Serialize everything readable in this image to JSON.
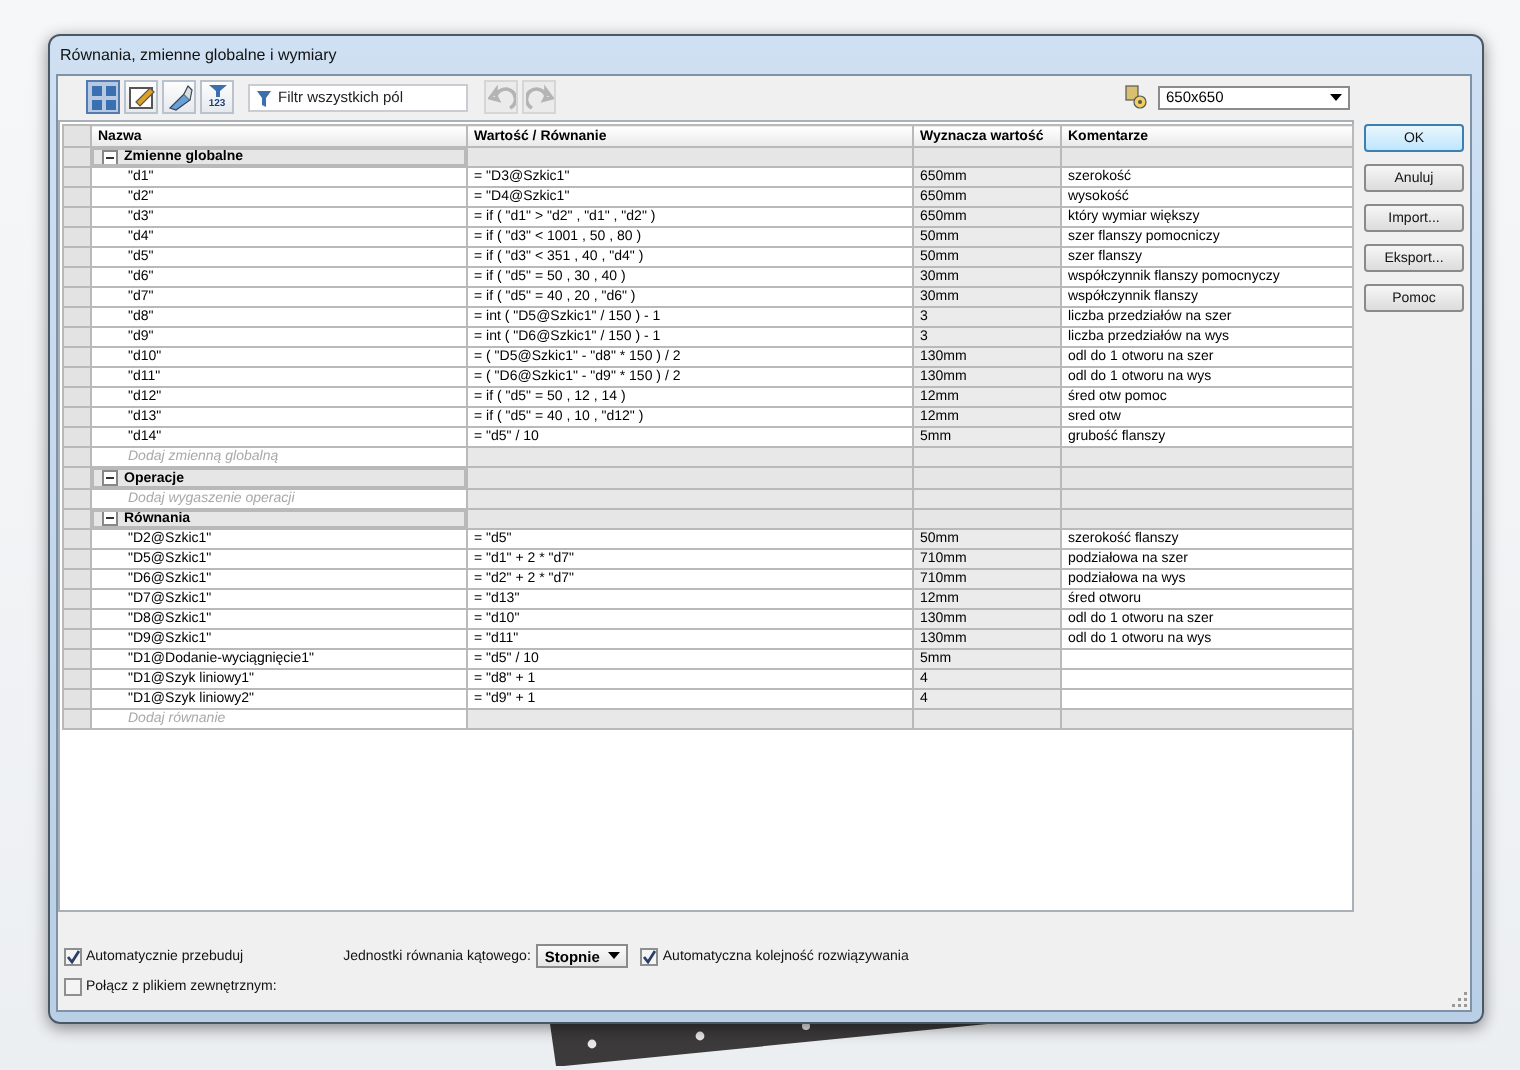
{
  "window": {
    "title": "Równania, zmienne globalne i wymiary"
  },
  "toolbar": {
    "views": [
      {
        "selected": true
      },
      {
        "selected": false
      },
      {
        "selected": false
      },
      {
        "selected": false,
        "label": "123"
      }
    ],
    "filter": {
      "placeholder": "Filtr wszystkich pól"
    },
    "undo": {
      "disabled": true
    },
    "redo": {
      "disabled": true
    },
    "configuration": {
      "value": "650x650"
    }
  },
  "table": {
    "columns": [
      "Nazwa",
      "Wartość / Równanie",
      "Wyznacza wartość",
      "Komentarze"
    ],
    "groups": [
      {
        "name": "Zmienne globalne",
        "expanded": true,
        "add_placeholder": "Dodaj zmienną globalną",
        "rows": [
          {
            "name": "\"d1\"",
            "value": "= \"D3@Szkic1\"",
            "result": "650mm",
            "comment": "szerokość"
          },
          {
            "name": "\"d2\"",
            "value": "= \"D4@Szkic1\"",
            "result": "650mm",
            "comment": "wysokość"
          },
          {
            "name": "\"d3\"",
            "value": "= if ( \"d1\" > \"d2\" , \"d1\" , \"d2\" )",
            "result": "650mm",
            "comment": "który wymiar większy"
          },
          {
            "name": "\"d4\"",
            "value": "= if ( \"d3\" < 1001 , 50 , 80 )",
            "result": "50mm",
            "comment": "szer flanszy pomocniczy"
          },
          {
            "name": "\"d5\"",
            "value": "= if ( \"d3\" < 351 , 40 , \"d4\" )",
            "result": "50mm",
            "comment": "szer flanszy"
          },
          {
            "name": "\"d6\"",
            "value": "= if ( \"d5\" = 50 , 30 , 40 )",
            "result": "30mm",
            "comment": "współczynnik flanszy pomocnyczy"
          },
          {
            "name": "\"d7\"",
            "value": "= if ( \"d5\" = 40 , 20 , \"d6\" )",
            "result": "30mm",
            "comment": "współczynnik flanszy"
          },
          {
            "name": "\"d8\"",
            "value": "= int ( \"D5@Szkic1\" / 150 ) - 1",
            "result": "3",
            "comment": "liczba przedziałów na szer"
          },
          {
            "name": "\"d9\"",
            "value": "= int ( \"D6@Szkic1\" / 150 ) - 1",
            "result": "3",
            "comment": "liczba przedziałów na wys"
          },
          {
            "name": "\"d10\"",
            "value": "= ( \"D5@Szkic1\" - \"d8\" * 150 ) / 2",
            "result": "130mm",
            "comment": "odl do 1 otworu na szer"
          },
          {
            "name": "\"d11\"",
            "value": "= ( \"D6@Szkic1\" - \"d9\" * 150 ) / 2",
            "result": "130mm",
            "comment": "odl do 1 otworu na wys"
          },
          {
            "name": "\"d12\"",
            "value": "= if ( \"d5\" = 50 , 12 , 14 )",
            "result": "12mm",
            "comment": "śred otw pomoc"
          },
          {
            "name": "\"d13\"",
            "value": "= if ( \"d5\" = 40 , 10 , \"d12\" )",
            "result": "12mm",
            "comment": "sred otw"
          },
          {
            "name": "\"d14\"",
            "value": "= \"d5\" / 10",
            "result": "5mm",
            "comment": "grubość flanszy"
          }
        ]
      },
      {
        "name": "Operacje",
        "expanded": true,
        "add_placeholder": "Dodaj wygaszenie operacji"
      },
      {
        "name": "Równania",
        "expanded": true,
        "add_placeholder": "Dodaj równanie",
        "rows": [
          {
            "name": "\"D2@Szkic1\"",
            "value": "= \"d5\"",
            "result": "50mm",
            "comment": "szerokość flanszy"
          },
          {
            "name": "\"D5@Szkic1\"",
            "value": "= \"d1\" + 2 * \"d7\"",
            "result": "710mm",
            "comment": "podziałowa na szer"
          },
          {
            "name": "\"D6@Szkic1\"",
            "value": "= \"d2\" + 2 * \"d7\"",
            "result": "710mm",
            "comment": "podziałowa na wys"
          },
          {
            "name": "\"D7@Szkic1\"",
            "value": "= \"d13\"",
            "result": "12mm",
            "comment": "śred otworu"
          },
          {
            "name": "\"D8@Szkic1\"",
            "value": "= \"d10\"",
            "result": "130mm",
            "comment": "odl do 1 otworu na szer"
          },
          {
            "name": "\"D9@Szkic1\"",
            "value": "= \"d11\"",
            "result": "130mm",
            "comment": "odl do 1 otworu na wys"
          },
          {
            "name": "\"D1@Dodanie-wyciągnięcie1\"",
            "value": "= \"d5\" / 10",
            "result": "5mm"
          },
          {
            "name": "\"D1@Szyk liniowy1\"",
            "value": "= \"d8\" + 1",
            "result": "4"
          },
          {
            "name": "\"D1@Szyk liniowy2\"",
            "value": "= \"d9\" + 1",
            "result": "4"
          }
        ]
      }
    ]
  },
  "buttons": [
    {
      "label": "OK",
      "default": true
    },
    {
      "label": "Anuluj",
      "default": false
    },
    {
      "label": "Import...",
      "default": false
    },
    {
      "label": "Eksport...",
      "default": false
    },
    {
      "label": "Pomoc",
      "default": false
    }
  ],
  "options": {
    "auto_rebuild": {
      "label": "Automatycznie przebuduj",
      "checked": true
    },
    "angle_units": {
      "label": "Jednostki równania kątowego:",
      "value": "Stopnie"
    },
    "auto_order": {
      "label": "Automatyczna kolejność rozwiązywania",
      "checked": true
    },
    "link_file": {
      "label": "Połącz z plikiem zewnętrznym:",
      "checked": false
    }
  }
}
